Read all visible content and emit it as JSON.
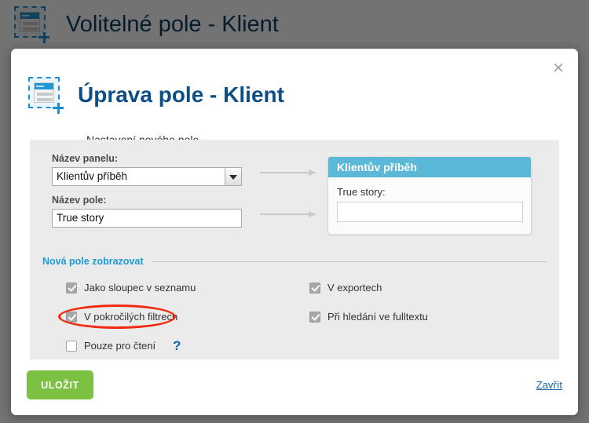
{
  "background": {
    "title": "Volitelné pole - Klient",
    "icon": "custom-field-icon"
  },
  "modal": {
    "title": "Úprava pole - Klient",
    "subtitle": "Nastavení nového pole...",
    "icon": "custom-field-icon",
    "close_icon": "×",
    "form": {
      "panel_name_label": "Název panelu:",
      "panel_name_value": "Klientův příběh",
      "field_name_label": "Název pole:",
      "field_name_value": "True story"
    },
    "preview": {
      "header": "Klientův příběh",
      "field_label": "True story:",
      "field_value": ""
    },
    "section": {
      "title": "Nová pole zobrazovat",
      "checkboxes_left": [
        {
          "label": "Jako sloupec v seznamu",
          "checked": true
        },
        {
          "label": "V pokročilých filtrech",
          "checked": true,
          "highlighted": true
        },
        {
          "label": "Pouze pro čtení",
          "checked": false,
          "help": "?"
        }
      ],
      "checkboxes_right": [
        {
          "label": "V exportech",
          "checked": true
        },
        {
          "label": "Při hledání ve fulltextu",
          "checked": true
        }
      ]
    },
    "footer": {
      "save_label": "ULOŽIT",
      "close_label": "Zavřít"
    }
  },
  "colors": {
    "accent_blue": "#1a9ad6",
    "title_blue": "#0d4e87",
    "preview_header": "#5bb8d6",
    "save_green": "#7cc141",
    "annotation_red": "#f12a10",
    "panel_gray": "#ebebeb"
  }
}
